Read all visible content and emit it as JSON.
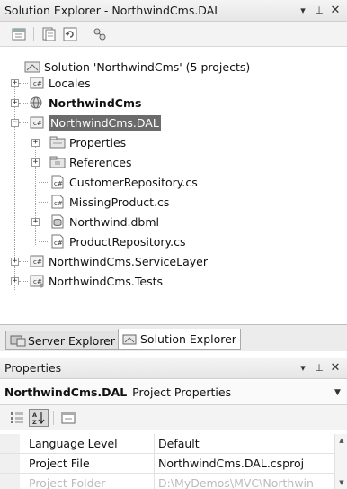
{
  "solution_explorer": {
    "title": "Solution Explorer - NorthwindCms.DAL",
    "pin_glyph": "▾ ⊥",
    "toolbar_icons": [
      "properties-icon",
      "show-all-files-icon",
      "refresh-icon",
      "class-view-icon"
    ],
    "tree": {
      "solution": "Solution 'NorthwindCms' (5 projects)",
      "projects": [
        {
          "label": "Locales",
          "bold": false,
          "expanded": false
        },
        {
          "label": "NorthwindCms",
          "bold": true,
          "expanded": false
        },
        {
          "label": "NorthwindCms.DAL",
          "bold": false,
          "expanded": true,
          "selected": true
        },
        {
          "label": "NorthwindCms.ServiceLayer",
          "bold": false,
          "expanded": false
        },
        {
          "label": "NorthwindCms.Tests",
          "bold": false,
          "expanded": false
        }
      ],
      "dal_children": [
        {
          "label": "Properties",
          "expandable": true
        },
        {
          "label": "References",
          "expandable": true
        },
        {
          "label": "CustomerRepository.cs",
          "expandable": false
        },
        {
          "label": "MissingProduct.cs",
          "expandable": false
        },
        {
          "label": "Northwind.dbml",
          "expandable": true
        },
        {
          "label": "ProductRepository.cs",
          "expandable": false
        }
      ]
    },
    "tabs": [
      {
        "label": "Server Explorer",
        "active": false
      },
      {
        "label": "Solution Explorer",
        "active": true
      }
    ]
  },
  "properties": {
    "title": "Properties",
    "object_name": "NorthwindCms.DAL",
    "object_type": "Project Properties",
    "toolbar_icons": [
      "categorized-icon",
      "alphabetical-icon",
      "property-pages-icon"
    ],
    "rows": [
      {
        "name": "Language Level",
        "value": "Default"
      },
      {
        "name": "Project File",
        "value": "NorthwindCms.DAL.csproj"
      },
      {
        "name": "Project Folder",
        "value": "D:\\MyDemos\\MVC\\Northwin"
      }
    ]
  },
  "colors": {
    "selection": "#6b6b6b",
    "pane_title": "#e9e9e9"
  }
}
